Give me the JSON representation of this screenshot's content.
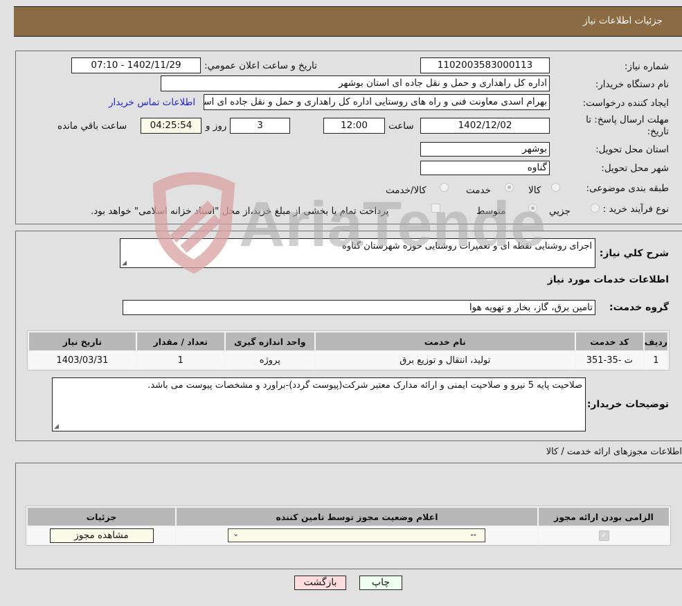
{
  "header": {
    "title": "جزئیات اطلاعات نیاز"
  },
  "fields": {
    "need_number": {
      "label": "شماره نیاز:",
      "value": "1102003583000113"
    },
    "announce_datetime": {
      "label": "تاریخ و ساعت اعلان عمومي:",
      "value": "1402/11/29 - 07:10"
    },
    "buyer_org": {
      "label": "نام دستگاه خریدار:",
      "value": "اداره کل راهداری و حمل و نقل جاده ای استان بوشهر"
    },
    "creator": {
      "label": "ایجاد کننده درخواست:",
      "value": "بهرام اسدی معاونت فنی و راه های روستایی اداره کل راهداری و حمل و نقل جاده ای استان بوشهر",
      "contact_link": "اطلاعات تماس خریدار"
    },
    "deadline": {
      "label": "مهلت ارسال پاسخ: تا تاریخ:",
      "date": "1402/12/02",
      "time_label": "ساعت",
      "time": "12:00",
      "days": "3",
      "days_label": "روز و",
      "remaining": "04:25:54",
      "remaining_label": "ساعت باقي مانده"
    },
    "province": {
      "label": "استان محل تحویل:",
      "value": "بوشهر"
    },
    "city": {
      "label": "شهر محل تحویل:",
      "value": "گناوه"
    },
    "category": {
      "label": "طبقه بندی موضوعی:",
      "options": [
        {
          "label": "کالا",
          "checked": false
        },
        {
          "label": "خدمت",
          "checked": true
        },
        {
          "label": "کالا/خدمت",
          "checked": false
        }
      ]
    },
    "purchase_type": {
      "label": "نوع فرآیند خرید :",
      "options": [
        {
          "label": "جزیي",
          "checked": false
        },
        {
          "label": "متوسط",
          "checked": true
        }
      ],
      "treasury_note": "پرداخت تمام یا بخشی از مبلغ خرید،از محل \"اسناد خزانه اسلامی\" خواهد بود."
    }
  },
  "description": {
    "label": "شرح کلي نیاز:",
    "value": "اجرای روشنایی نقطه ای و تعمیرات روشنایی حوزه شهرستان گناوه"
  },
  "services_section": {
    "title": "اطلاعات خدمات مورد نیاز",
    "group_label": "گروه خدمت:",
    "group_value": "تامین برق، گاز، بخار و تهویه هوا",
    "table": {
      "headers": [
        "ردیف",
        "کد خدمت",
        "نام خدمت",
        "واحد اندازه گیری",
        "تعداد / مقدار",
        "تاریخ نیاز"
      ],
      "rows": [
        [
          "1",
          "ت -35-351",
          "تولید، انتقال و توزیع برق",
          "پروژه",
          "1",
          "1403/03/31"
        ]
      ]
    },
    "buyer_notes_label": "توضیحات خریدار:",
    "buyer_notes": "صلاحیت پایه 5 نیرو و صلاحیت ایمنی و ارائه مدارک معتبر شرکت(پیوست گردد)-براورد و مشخصات پیوست می باشد."
  },
  "permits": {
    "title": "اطلاعات مجوزهای ارائه خدمت / کالا",
    "headers": [
      "الزامی بودن ارائه مجوز",
      "اعلام وضعیت مجوز توسط تامین کننده",
      "جزئیات"
    ],
    "row": {
      "required": true,
      "status_value": "--",
      "details_button": "مشاهده مجوز"
    }
  },
  "buttons": {
    "print": "چاپ",
    "back": "بازگشت"
  },
  "watermark": {
    "text": "AriaTender.neT"
  },
  "colors": {
    "header_bg": "#8b6b43",
    "link": "#2020c8",
    "print_bg": "#eeffee",
    "back_bg": "#ffdddd"
  }
}
